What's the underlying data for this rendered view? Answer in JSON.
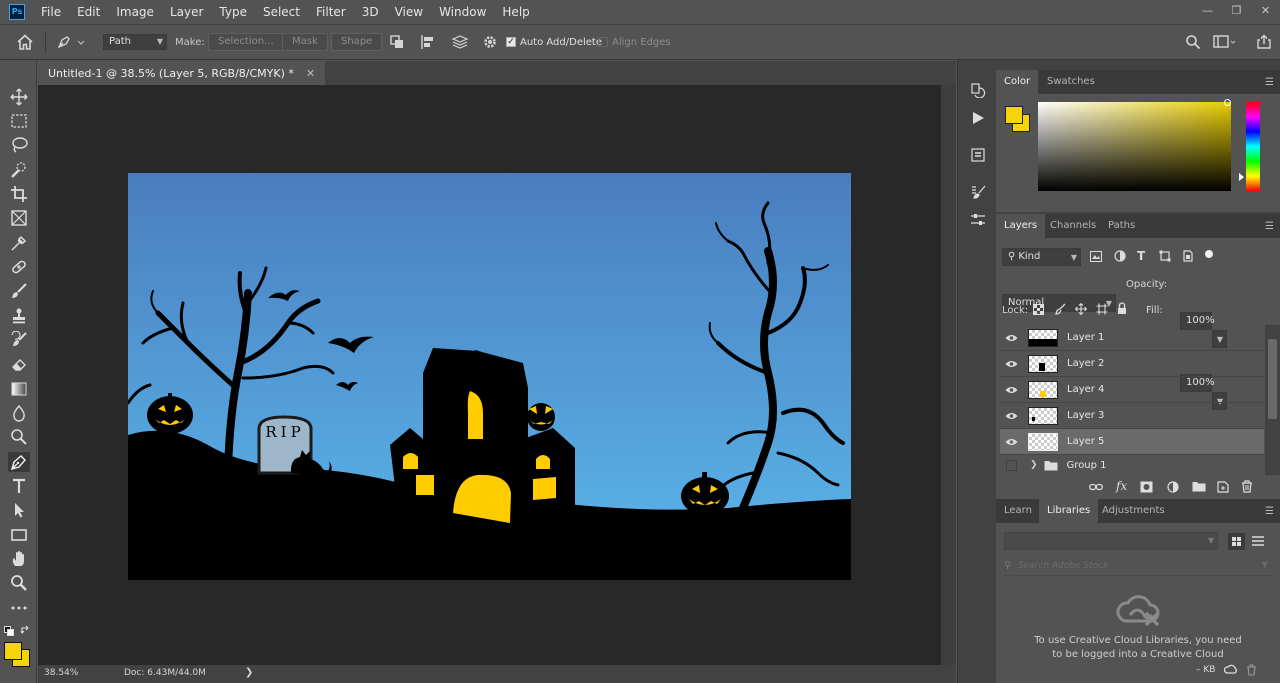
{
  "app": {
    "logo_text": "Ps",
    "menus": [
      "File",
      "Edit",
      "Image",
      "Layer",
      "Type",
      "Select",
      "Filter",
      "3D",
      "View",
      "Window",
      "Help"
    ]
  },
  "options_bar": {
    "mode_value": "Path",
    "make_label": "Make:",
    "selection_button": "Selection...",
    "mask_button": "Mask",
    "shape_button": "Shape",
    "auto_add_delete_label": "Auto Add/Delete",
    "auto_add_delete_checked": true,
    "align_edges_label": "Align Edges",
    "align_edges_checked": false
  },
  "document": {
    "tab_title": "Untitled-1 @ 38.5% (Layer 5, RGB/8/CMYK) *",
    "zoom": "38.54%",
    "doc_size": "Doc: 6.43M/44.0M"
  },
  "artwork": {
    "rip_text": "RIP",
    "sky_top": "#4a7dbf",
    "sky_bottom": "#5bb8ec",
    "accent_yellow": "#ffcc00"
  },
  "color_panel": {
    "tabs": [
      "Color",
      "Swatches"
    ],
    "foreground": "#f6d40c",
    "background": "#f6d40c"
  },
  "layers_panel": {
    "tabs": [
      "Layers",
      "Channels",
      "Paths"
    ],
    "filter_kind": "Kind",
    "blend_mode": "Normal",
    "opacity_label": "Opacity:",
    "opacity_value": "100%",
    "lock_label": "Lock:",
    "fill_label": "Fill:",
    "fill_value": "100%",
    "layers": [
      {
        "name": "Layer 1",
        "visible": true,
        "selected": false
      },
      {
        "name": "Layer 2",
        "visible": true,
        "selected": false
      },
      {
        "name": "Layer 4",
        "visible": true,
        "selected": false
      },
      {
        "name": "Layer 3",
        "visible": true,
        "selected": false
      },
      {
        "name": "Layer 5",
        "visible": true,
        "selected": true
      },
      {
        "name": "Group 1",
        "visible": false,
        "selected": false
      }
    ]
  },
  "libraries_panel": {
    "tabs": [
      "Learn",
      "Libraries",
      "Adjustments"
    ],
    "search_placeholder": "Search Adobe Stock",
    "message_line1": "To use Creative Cloud Libraries, you need",
    "message_line2": "to be logged into a Creative Cloud",
    "footer_kb": "– KB"
  }
}
